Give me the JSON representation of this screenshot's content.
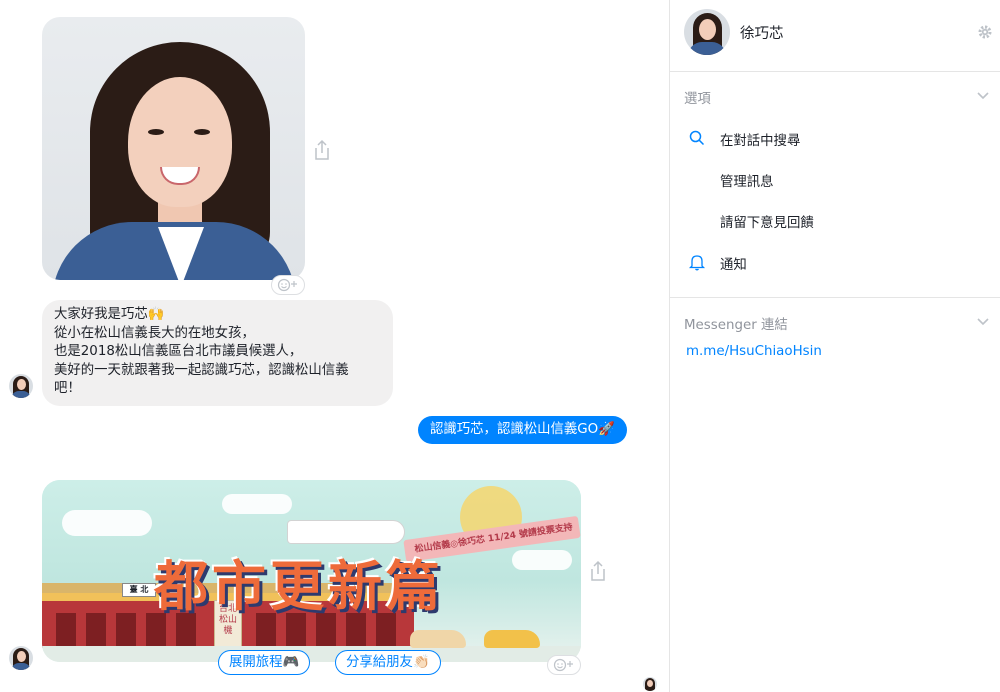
{
  "chat": {
    "messages": {
      "intro_lines": [
        "大家好我是巧芯🙌",
        "從小在松山信義長大的在地女孩，",
        "也是2018松山信義區台北市議員候選人，",
        "美好的一天就跟著我一起認識巧芯，認識松山信義",
        "吧！"
      ],
      "outgoing": "認識巧芯，認識松山信義GO🚀"
    },
    "banner": {
      "title": "都市更新篇",
      "ribbon_text": "松山信義◎徐巧芯 11/24 號請投票支持",
      "sign_text": "臺 北",
      "tower_text": "台北松山機"
    },
    "buttons": {
      "expand": "展開旅程🎮",
      "share": "分享給朋友👏🏻"
    }
  },
  "panel": {
    "contact_name": "徐巧芯",
    "options_title": "選項",
    "options": {
      "search": "在對話中搜尋",
      "manage": "管理訊息",
      "feedback": "請留下意見回饋",
      "notifications": "通知"
    },
    "links_title": "Messenger 連結",
    "link_url": "m.me/HsuChiaoHsin"
  },
  "colors": {
    "accent": "#0084ff",
    "incoming_bubble": "#f1f0f0",
    "banner_title": "#ee6b3a"
  },
  "icons": [
    "share-icon",
    "add-reaction-icon",
    "search-icon",
    "bell-icon",
    "gear-icon",
    "chevron-down-icon"
  ]
}
